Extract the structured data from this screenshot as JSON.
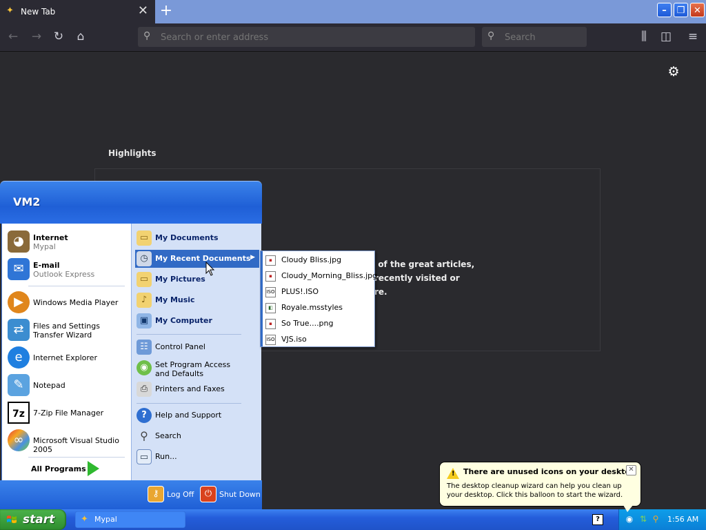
{
  "browser": {
    "tab_title": "New Tab",
    "tab_close": "✕",
    "new_tab": "+",
    "url_placeholder": "Search or enter address",
    "search_placeholder": "Search",
    "win_min": "–",
    "win_max": "❐",
    "win_close": "✕"
  },
  "content": {
    "highlights_title": "Highlights",
    "hl_line1": "e of the great articles,",
    "hl_line2": "recently visited or",
    "hl_line3": "re."
  },
  "start_menu": {
    "user": "VM2",
    "left_items": [
      {
        "label": "Internet",
        "sub": "Mypal",
        "icon": "mypal-icon"
      },
      {
        "label": "E-mail",
        "sub": "Outlook Express",
        "icon": "email-icon"
      },
      {
        "label": "Windows Media Player",
        "icon": "media-player-icon"
      },
      {
        "label": "Files and Settings Transfer Wizard",
        "icon": "transfer-wizard-icon"
      },
      {
        "label": "Internet Explorer",
        "icon": "ie-icon"
      },
      {
        "label": "Notepad",
        "icon": "notepad-icon"
      },
      {
        "label": "7-Zip File Manager",
        "icon": "7zip-icon"
      },
      {
        "label": "Microsoft Visual Studio 2005",
        "icon": "visual-studio-icon"
      }
    ],
    "all_programs": "All Programs",
    "right_items": [
      {
        "label": "My Documents"
      },
      {
        "label": "My Recent Documents"
      },
      {
        "label": "My Pictures"
      },
      {
        "label": "My Music"
      },
      {
        "label": "My Computer"
      },
      {
        "label": "Control Panel"
      },
      {
        "label": "Set Program Access and Defaults"
      },
      {
        "label": "Printers and Faxes"
      },
      {
        "label": "Help and Support"
      },
      {
        "label": "Search"
      },
      {
        "label": "Run..."
      }
    ],
    "log_off": "Log Off",
    "shut_down": "Shut Down"
  },
  "recent_docs": [
    {
      "name": "Cloudy Bliss.jpg",
      "type": "image"
    },
    {
      "name": "Cloudy_Morning_Bliss.jpg",
      "type": "image"
    },
    {
      "name": "PLUS!.ISO",
      "type": "iso"
    },
    {
      "name": "Royale.msstyles",
      "type": "theme"
    },
    {
      "name": "So True....png",
      "type": "image"
    },
    {
      "name": "VJS.iso",
      "type": "iso"
    }
  ],
  "taskbar": {
    "start": "start",
    "task_mypal": "Mypal",
    "help": "?",
    "clock": "1:56 AM"
  },
  "balloon": {
    "title": "There are unused icons on your desktop",
    "body": "The desktop cleanup wizard can help you clean up your desktop. Click this balloon to start the wizard.",
    "close": "✕"
  },
  "colors": {
    "xp_blue": "#245ddb",
    "start_green": "#2e8d2e",
    "highlight": "#316ac5"
  }
}
